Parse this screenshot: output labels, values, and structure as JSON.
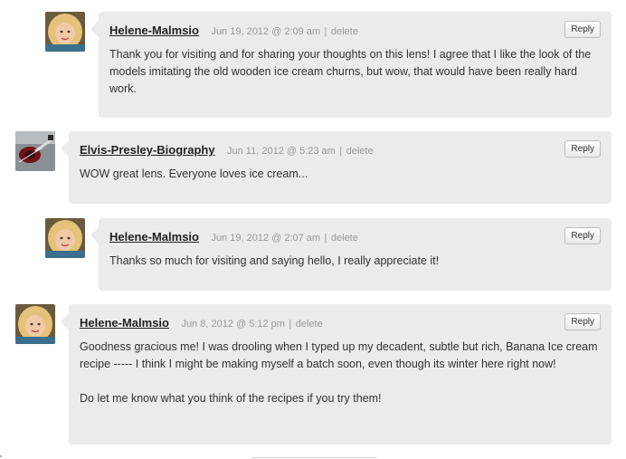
{
  "comments": [
    {
      "author": "Helene-Malmsio",
      "date": "Jun 19, 2012 @ 2:09 am",
      "separator": "|",
      "delete_label": "delete",
      "reply_label": "Reply",
      "avatar": "helene-avatar",
      "paragraphs": [
        "Thank you for visiting and for sharing your thoughts on this lens! I agree that I like the look of the models imitating the old wooden ice cream churns, but wow, that would have been really hard work."
      ]
    },
    {
      "author": "Elvis-Presley-Biography",
      "date": "Jun 11, 2012 @ 5:23 am",
      "separator": "|",
      "delete_label": "delete",
      "reply_label": "Reply",
      "avatar": "guitar-avatar",
      "paragraphs": [
        "WOW great lens. Everyone loves ice cream..."
      ]
    },
    {
      "author": "Helene-Malmsio",
      "date": "Jun 19, 2012 @ 2:07 am",
      "separator": "|",
      "delete_label": "delete",
      "reply_label": "Reply",
      "avatar": "helene-avatar",
      "paragraphs": [
        "Thanks so much for visiting and saying hello, I really appreciate it!"
      ]
    },
    {
      "author": "Helene-Malmsio",
      "date": "Jun 8, 2012 @ 5:12 pm",
      "separator": "|",
      "delete_label": "delete",
      "reply_label": "Reply",
      "avatar": "helene-avatar",
      "paragraphs": [
        "Goodness gracious me! I was drooling when I typed up my decadent, subtle but rich, Banana Ice cream recipe ----- I think I might be making myself a batch soon, even though its winter here right now!",
        "Do let me know what you think of the recipes if you try them!"
      ]
    }
  ],
  "colors": {
    "bubble": "#ebebeb",
    "author": "#222222",
    "meta": "#999999",
    "text": "#333333"
  }
}
